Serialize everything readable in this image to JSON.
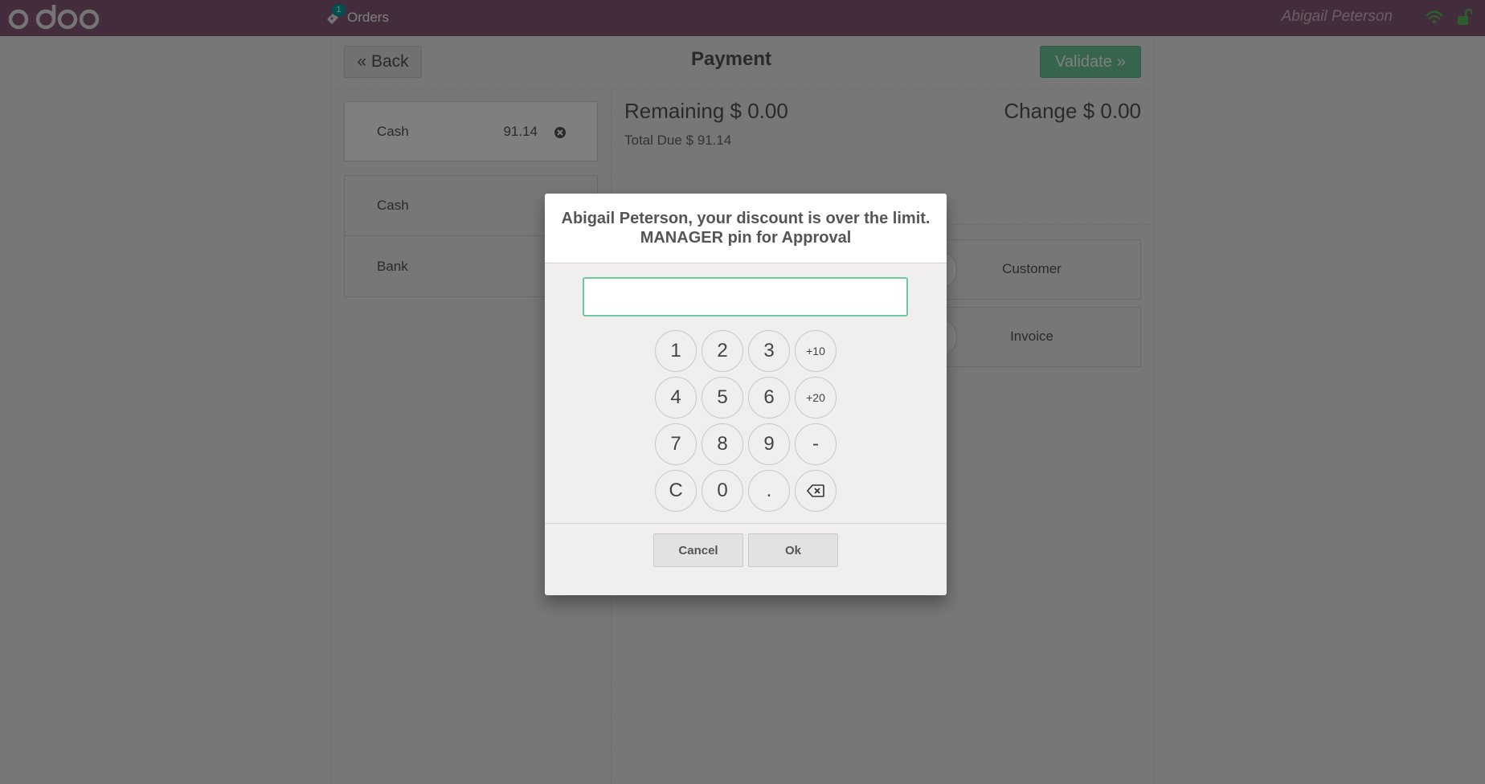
{
  "navbar": {
    "logo_text": "odoo",
    "orders_label": "Orders",
    "orders_count": "1",
    "cashier": "Abigail Peterson"
  },
  "payment": {
    "back_label": "Back",
    "title": "Payment",
    "validate_label": "Validate",
    "paymentline": {
      "name": "Cash",
      "amount": "91.14"
    },
    "methods": [
      {
        "label": "Cash"
      },
      {
        "label": "Bank"
      }
    ],
    "remaining_label": "Remaining",
    "remaining_value": "$ 0.00",
    "change_label": "Change",
    "change_value": "$ 0.00",
    "total_due_label": "Total Due",
    "total_due_value": "$ 91.14",
    "customer_label": "Customer",
    "invoice_label": "Invoice"
  },
  "modal": {
    "title_line1": "Abigail Peterson, your discount is over the limit.",
    "title_line2": "MANAGER pin for Approval",
    "pin_value": "",
    "keys": [
      "1",
      "2",
      "3",
      "+10",
      "4",
      "5",
      "6",
      "+20",
      "7",
      "8",
      "9",
      "-",
      "C",
      "0",
      "."
    ],
    "cancel_label": "Cancel",
    "ok_label": "Ok"
  },
  "colors": {
    "navbar": "#875a7b",
    "accent_green": "#6ec89b",
    "badge": "#00a09d"
  }
}
